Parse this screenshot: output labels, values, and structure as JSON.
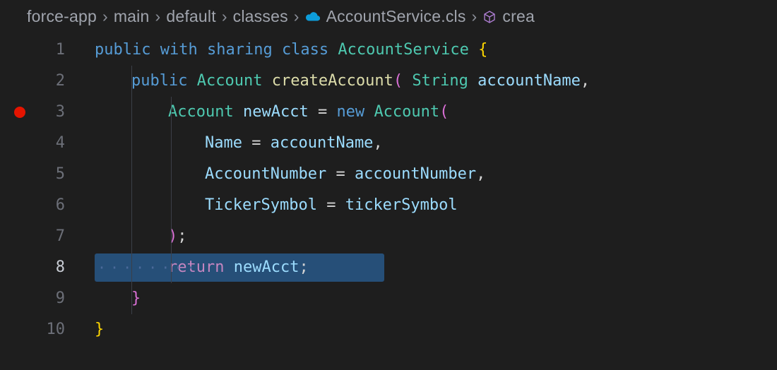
{
  "breadcrumb": {
    "items": [
      "force-app",
      "main",
      "default",
      "classes",
      "AccountService.cls",
      "crea"
    ]
  },
  "colors": {
    "breakpoint": "#e51400",
    "highlight": "#264f78"
  },
  "code": {
    "lines": [
      {
        "num": 1,
        "tokens": [
          {
            "t": "kw",
            "v": "public"
          },
          {
            "t": "sp",
            "v": " "
          },
          {
            "t": "kw",
            "v": "with"
          },
          {
            "t": "sp",
            "v": " "
          },
          {
            "t": "kw",
            "v": "sharing"
          },
          {
            "t": "sp",
            "v": " "
          },
          {
            "t": "kw",
            "v": "class"
          },
          {
            "t": "sp",
            "v": " "
          },
          {
            "t": "type",
            "v": "AccountService"
          },
          {
            "t": "sp",
            "v": " "
          },
          {
            "t": "brace2",
            "v": "{"
          }
        ],
        "indent": 0
      },
      {
        "num": 2,
        "tokens": [
          {
            "t": "kw",
            "v": "public"
          },
          {
            "t": "sp",
            "v": " "
          },
          {
            "t": "type",
            "v": "Account"
          },
          {
            "t": "sp",
            "v": " "
          },
          {
            "t": "fn",
            "v": "createAccount"
          },
          {
            "t": "brace",
            "v": "("
          },
          {
            "t": "sp",
            "v": " "
          },
          {
            "t": "type",
            "v": "String"
          },
          {
            "t": "sp",
            "v": " "
          },
          {
            "t": "id",
            "v": "accountName"
          },
          {
            "t": "punc",
            "v": ","
          }
        ],
        "indent": 1
      },
      {
        "num": 3,
        "breakpoint": true,
        "tokens": [
          {
            "t": "type",
            "v": "Account"
          },
          {
            "t": "sp",
            "v": " "
          },
          {
            "t": "id",
            "v": "newAcct"
          },
          {
            "t": "sp",
            "v": " "
          },
          {
            "t": "punc",
            "v": "="
          },
          {
            "t": "sp",
            "v": " "
          },
          {
            "t": "kw",
            "v": "new"
          },
          {
            "t": "sp",
            "v": " "
          },
          {
            "t": "type",
            "v": "Account"
          },
          {
            "t": "brace",
            "v": "("
          }
        ],
        "indent": 2
      },
      {
        "num": 4,
        "tokens": [
          {
            "t": "id",
            "v": "Name"
          },
          {
            "t": "sp",
            "v": " "
          },
          {
            "t": "punc",
            "v": "="
          },
          {
            "t": "sp",
            "v": " "
          },
          {
            "t": "id",
            "v": "accountName"
          },
          {
            "t": "punc",
            "v": ","
          }
        ],
        "indent": 3
      },
      {
        "num": 5,
        "tokens": [
          {
            "t": "id",
            "v": "AccountNumber"
          },
          {
            "t": "sp",
            "v": " "
          },
          {
            "t": "punc",
            "v": "="
          },
          {
            "t": "sp",
            "v": " "
          },
          {
            "t": "id",
            "v": "accountNumber"
          },
          {
            "t": "punc",
            "v": ","
          }
        ],
        "indent": 3
      },
      {
        "num": 6,
        "tokens": [
          {
            "t": "id",
            "v": "TickerSymbol"
          },
          {
            "t": "sp",
            "v": " "
          },
          {
            "t": "punc",
            "v": "="
          },
          {
            "t": "sp",
            "v": " "
          },
          {
            "t": "id",
            "v": "tickerSymbol"
          }
        ],
        "indent": 3
      },
      {
        "num": 7,
        "tokens": [
          {
            "t": "brace",
            "v": ")"
          },
          {
            "t": "punc",
            "v": ";"
          }
        ],
        "indent": 2
      },
      {
        "num": 8,
        "active": true,
        "highlighted": true,
        "tokens": [
          {
            "t": "kw2",
            "v": "return"
          },
          {
            "t": "sp",
            "v": " "
          },
          {
            "t": "id",
            "v": "newAcct"
          },
          {
            "t": "punc",
            "v": ";"
          }
        ],
        "indent": 2,
        "showWhitespace": true
      },
      {
        "num": 9,
        "tokens": [
          {
            "t": "brace",
            "v": "}"
          }
        ],
        "indent": 1
      },
      {
        "num": 10,
        "tokens": [
          {
            "t": "brace2",
            "v": "}"
          }
        ],
        "indent": 0
      }
    ]
  }
}
